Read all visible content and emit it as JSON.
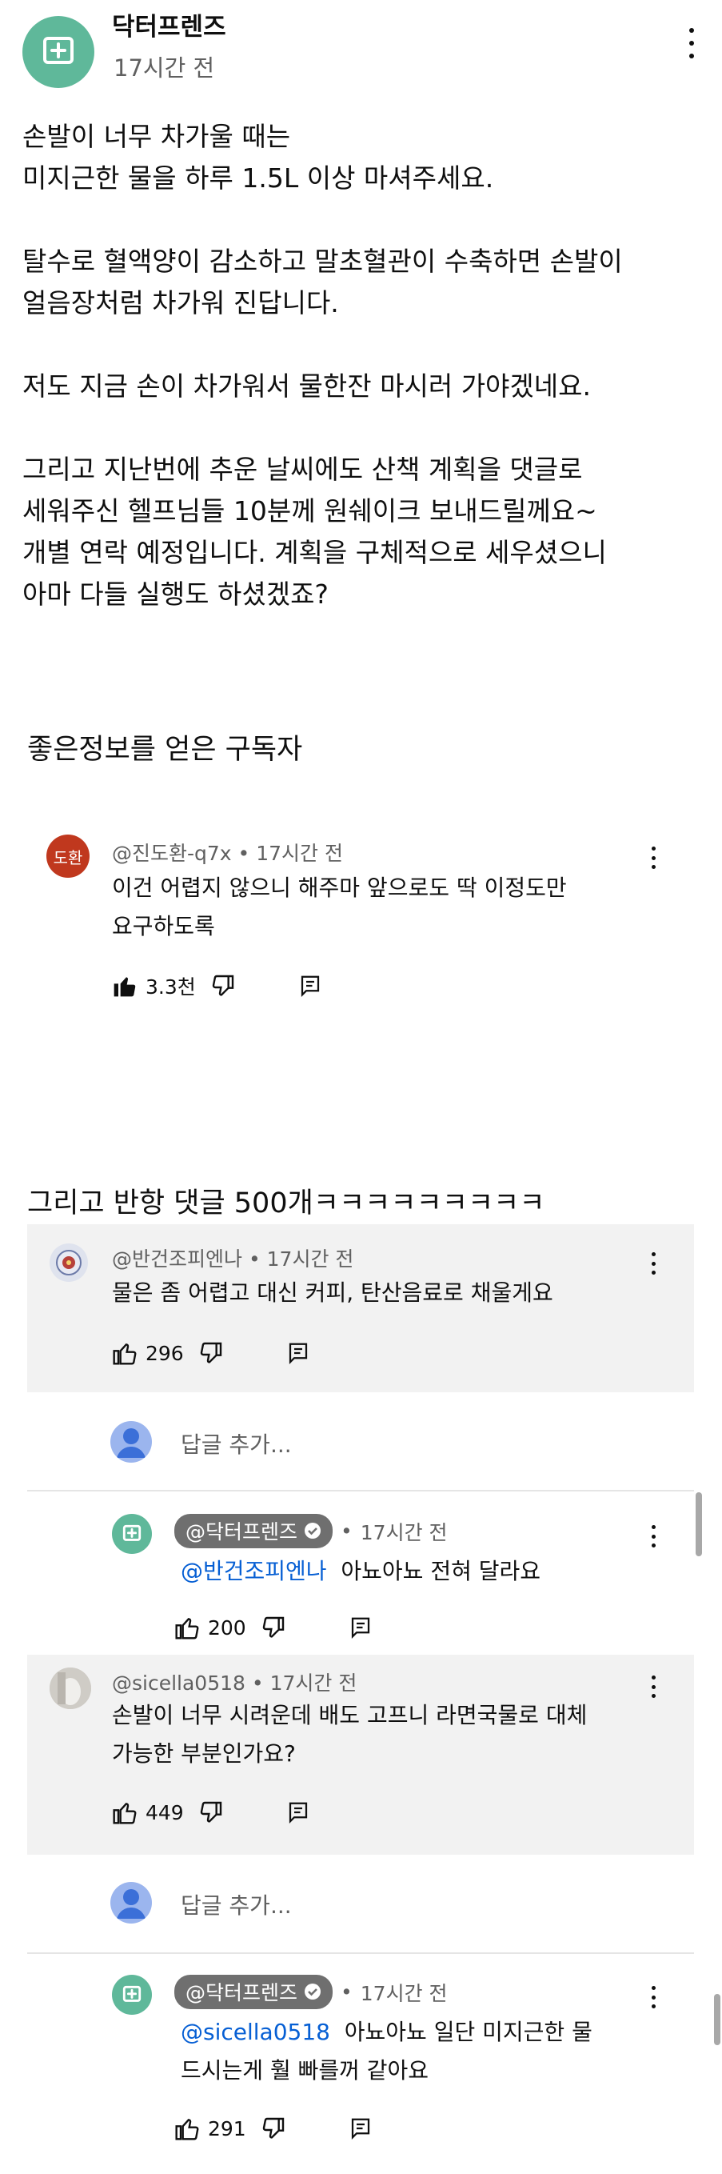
{
  "post": {
    "author": "닥터프렌즈",
    "time": "17시간 전",
    "lines": [
      "손발이 너무 차가울 때는",
      "미지근한 물을 하루 1.5L 이상 마셔주세요.",
      "",
      "탈수로 혈액양이 감소하고 말초혈관이 수축하면 손발이",
      "얼음장처럼 차가워 진답니다.",
      "",
      "저도 지금 손이 차가워서 물한잔 마시러 가야겠네요.",
      "",
      "그리고 지난번에 추운 날씨에도 산책 계획을 댓글로",
      "세워주신 헬프님들 10분께 원쉐이크 보내드릴께요~",
      "개별 연락 예정입니다. 계획을 구체적으로 세우셨으니",
      "아마 다들 실행도 하셨겠죠?"
    ]
  },
  "captions": {
    "first": "좋은정보를 얻은 구독자",
    "second": "그리고 반항 댓글 500개ㅋㅋㅋㅋㅋㅋㅋㅋㅋ"
  },
  "comment1": {
    "avatar_text": "도환",
    "author": "@진도환-q7x",
    "time": "17시간 전",
    "lines": [
      "이건 어렵지 않으니 해주마 앞으로도 딱 이정도만",
      "요구하도록"
    ],
    "likes": "3.3천"
  },
  "comment2": {
    "author": "@반건조피엔나",
    "time": "17시간 전",
    "text": "물은 좀 어렵고 대신 커피, 탄산음료로 채울게요",
    "likes": "296"
  },
  "add_reply": "답글 추가...",
  "reply1": {
    "author": "@닥터프렌즈",
    "time": "17시간 전",
    "mention": "@반건조피엔나",
    "text": "아뇨아뇨 전혀 달라요",
    "likes": "200"
  },
  "comment3": {
    "author": "@sicella0518",
    "time": "17시간 전",
    "lines": [
      "손발이 너무 시려운데 배도 고프니 라면국물로 대체",
      "가능한 부분인가요?"
    ],
    "likes": "449"
  },
  "reply2": {
    "author": "@닥터프렌즈",
    "time": "17시간 전",
    "mention": "@sicella0518",
    "line1": "아뇨아뇨 일단 미지근한 물",
    "line2": "드시는게 훨 빠를꺼 같아요",
    "likes": "291"
  },
  "colors": {
    "brand_green": "#5fb89a",
    "avatar_red": "#c0381e",
    "mention_blue": "#065fd4",
    "reply_bg": "#f2f2f2"
  }
}
